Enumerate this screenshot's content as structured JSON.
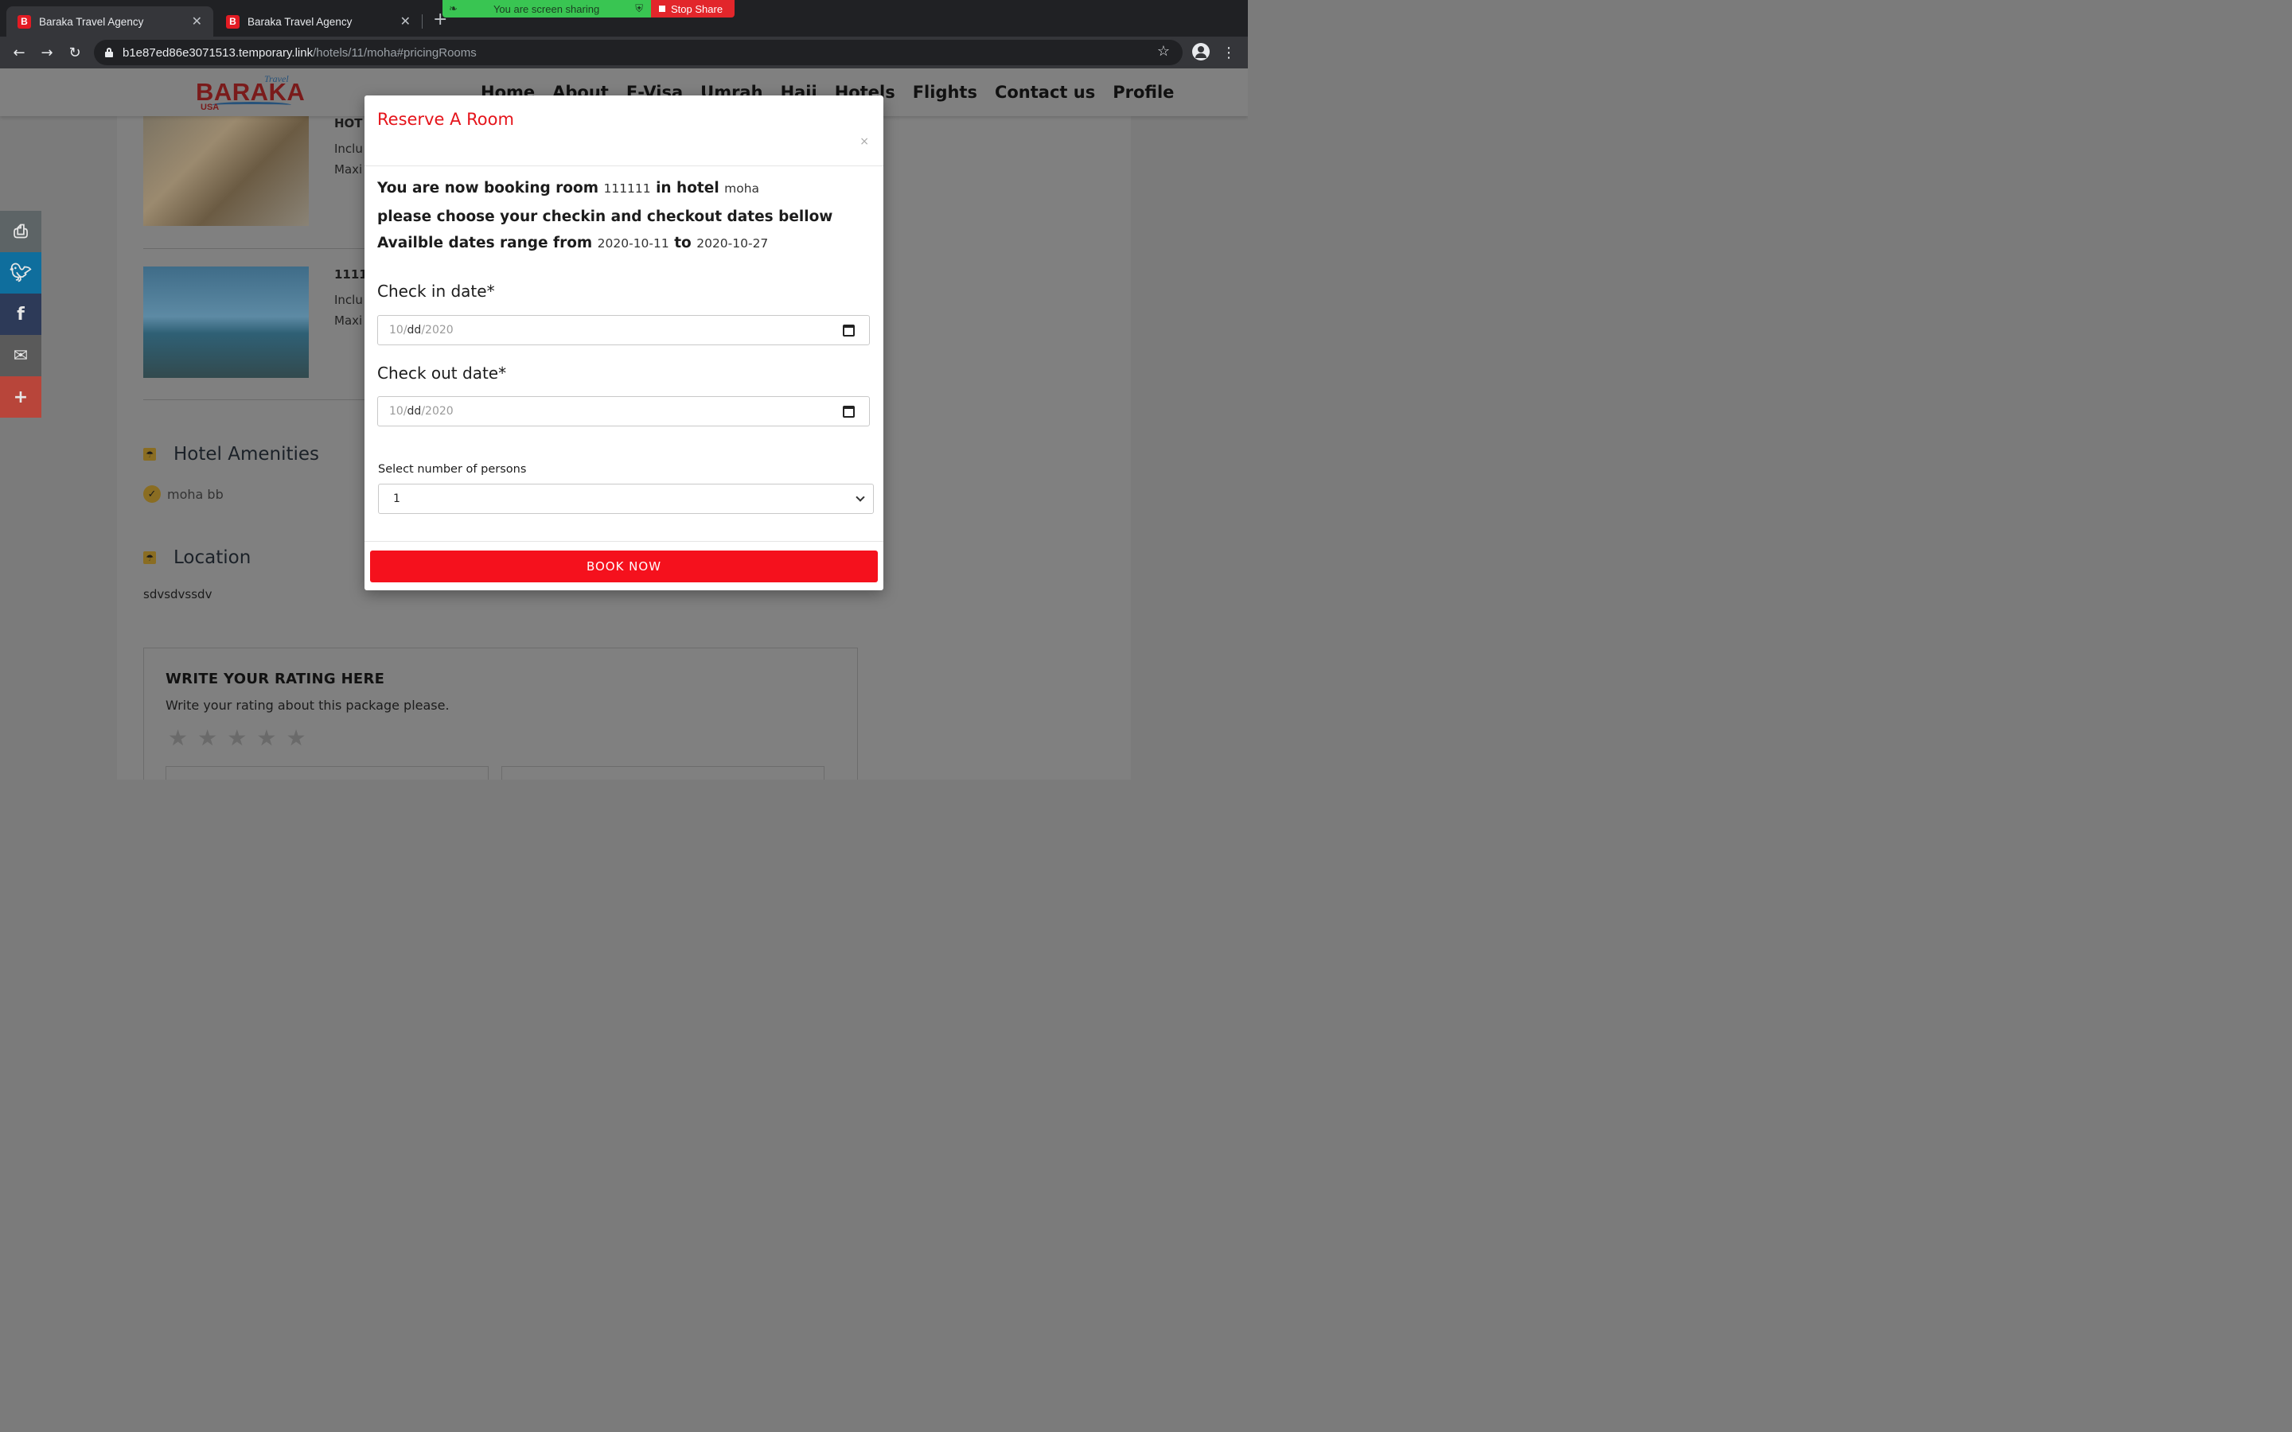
{
  "browser": {
    "tabs": [
      {
        "favicon": "B",
        "title": "Baraka Travel Agency",
        "close": "✕"
      },
      {
        "favicon": "B",
        "title": "Baraka Travel Agency",
        "close": "✕"
      }
    ],
    "new_tab": "+",
    "screen_share": {
      "message": "You are screen sharing",
      "stop_label": "Stop Share"
    },
    "url_host": "b1e87ed86e3071513.temporary.link",
    "url_path": "/hotels/11/moha#pricingRooms",
    "icons": {
      "back": "←",
      "forward": "→",
      "reload": "↻",
      "star": "☆",
      "menu": "⋮"
    }
  },
  "site": {
    "logo": {
      "main": "BARAKA",
      "travel": "Travel",
      "usa": "USA"
    },
    "nav": [
      "Home",
      "About",
      "E-Visa",
      "Umrah",
      "Hajj",
      "Hotels",
      "Flights",
      "Contact us",
      "Profile"
    ]
  },
  "rooms": [
    {
      "title": "HOT",
      "line1": "Inclu",
      "line2": "Maxi"
    },
    {
      "title": "11111",
      "line1": "Inclu",
      "line2": "Maxi"
    }
  ],
  "amenities": {
    "heading": "Hotel Amenities",
    "items": [
      "moha bb"
    ]
  },
  "location": {
    "heading": "Location",
    "text": "sdvsdvssdv"
  },
  "rating": {
    "title": "WRITE YOUR RATING HERE",
    "subtitle": "Write your rating about this package please.",
    "stars": [
      "★",
      "★",
      "★",
      "★",
      "★"
    ]
  },
  "social": [
    "print",
    "twitter",
    "facebook",
    "email",
    "more"
  ],
  "modal": {
    "title": "Reserve A Room",
    "close": "×",
    "booking_prefix": "You are now booking room",
    "room_number": "111111",
    "hotel_word": "in hotel",
    "hotel_name": "moha",
    "choose_text": "please choose your checkin and checkout dates bellow",
    "range_prefix": "Availble dates range from",
    "range_start": "2020-10-11",
    "range_to": "to",
    "range_end": "2020-10-27",
    "checkin_label": "Check in date*",
    "checkin_value": {
      "mm": "10",
      "dd": "dd",
      "yyyy": "2020"
    },
    "checkout_label": "Check out date*",
    "checkout_value": {
      "mm": "10",
      "dd": "dd",
      "yyyy": "2020"
    },
    "persons_label": "Select number of persons",
    "persons_value": "1",
    "book_label": "BOOK NOW"
  }
}
